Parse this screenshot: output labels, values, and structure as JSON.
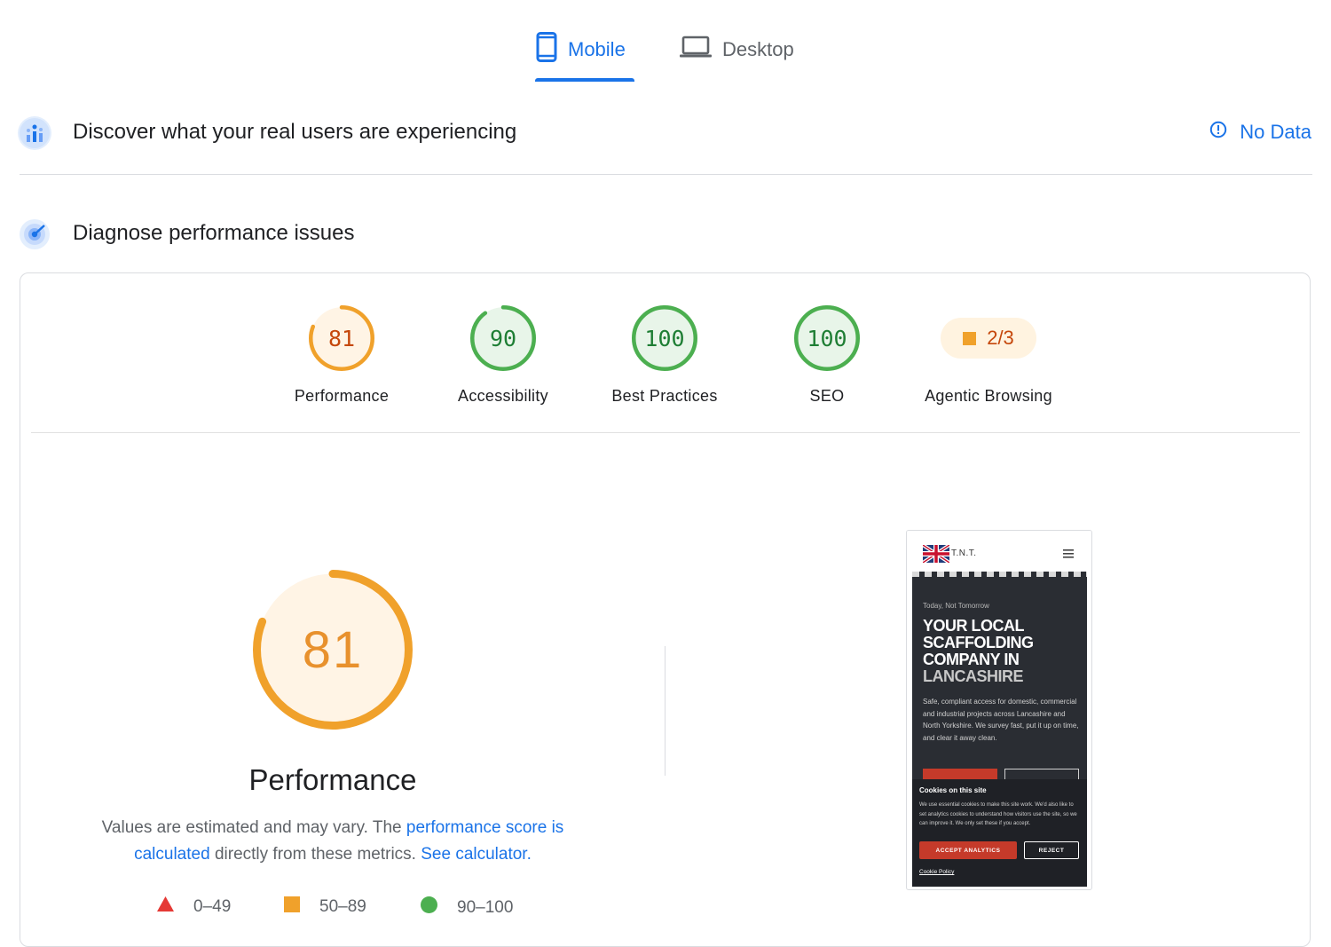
{
  "tabs": {
    "mobile": "Mobile",
    "desktop": "Desktop",
    "active": "mobile"
  },
  "field_data": {
    "title": "Discover what your real users are experiencing",
    "status": "No Data"
  },
  "diagnose": {
    "title": "Diagnose performance issues"
  },
  "scores": [
    {
      "label": "Performance",
      "value": "81",
      "score": 81,
      "rating": "average"
    },
    {
      "label": "Accessibility",
      "value": "90",
      "score": 90,
      "rating": "pass"
    },
    {
      "label": "Best Practices",
      "value": "100",
      "score": 100,
      "rating": "pass"
    },
    {
      "label": "SEO",
      "value": "100",
      "score": 100,
      "rating": "pass"
    },
    {
      "label": "Agentic Browsing",
      "value": "2/3",
      "rating": "average"
    }
  ],
  "performance_detail": {
    "score": "81",
    "score_value": 81,
    "title": "Performance",
    "desc_1": "Values are estimated and may vary. The ",
    "link_1": "performance score is calculated",
    "desc_2": " directly from these metrics. ",
    "link_2": "See calculator."
  },
  "legend": [
    {
      "range": "0–49",
      "shape": "triangle",
      "color": "#e53935"
    },
    {
      "range": "50–89",
      "shape": "square",
      "color": "#f0a12b"
    },
    {
      "range": "90–100",
      "shape": "circle",
      "color": "#4caf50"
    }
  ],
  "colors": {
    "accent": "#1a73e8",
    "average": "#f0a12b",
    "average_text": "#c5470b",
    "pass": "#4caf50",
    "pass_text": "#1e7e34",
    "fail": "#e53935"
  },
  "screenshot": {
    "logo_text": "T.N.T.",
    "tagline": "Today, Not Tomorrow",
    "heading_lines": [
      "YOUR LOCAL",
      "SCAFFOLDING",
      "COMPANY IN",
      "LANCASHIRE"
    ],
    "body": "Safe, compliant access for domestic, commercial and industrial projects across Lancashire and North Yorkshire. We survey fast, put it up on time, and clear it away clean.",
    "cookie_title": "Cookies on this site",
    "cookie_text": "We use essential cookies to make this site work. We'd also like to set analytics cookies to understand how visitors use the site, so we can improve it. We only set these if you accept.",
    "accept": "ACCEPT ANALYTICS",
    "reject": "REJECT",
    "policy": "Cookie Policy"
  }
}
